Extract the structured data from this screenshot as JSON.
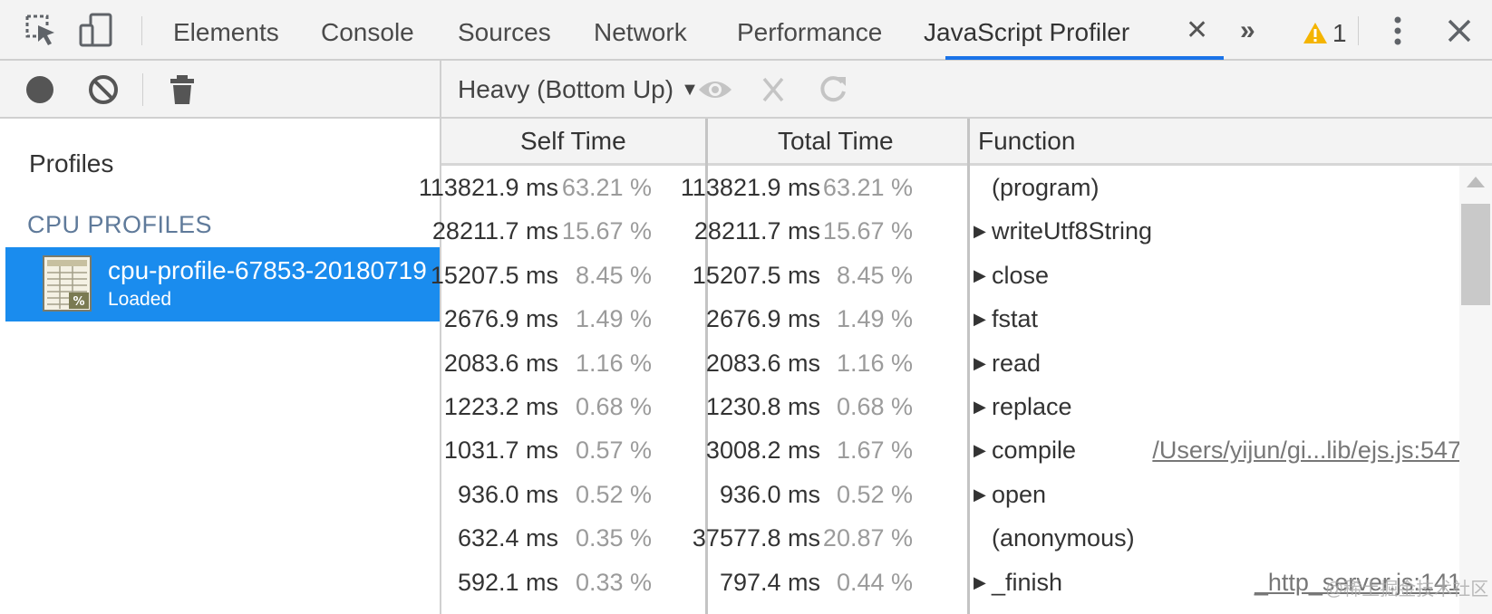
{
  "tabs": [
    {
      "label": "Elements"
    },
    {
      "label": "Console"
    },
    {
      "label": "Sources"
    },
    {
      "label": "Network"
    },
    {
      "label": "Performance"
    },
    {
      "label": "JavaScript Profiler",
      "active": true
    }
  ],
  "warnings": {
    "count": "1"
  },
  "sidebar": {
    "title": "Profiles",
    "section_header": "CPU PROFILES",
    "profile": {
      "name": "cpu-profile-67853-20180719",
      "status": "Loaded"
    }
  },
  "toolbar": {
    "view_mode": "Heavy (Bottom Up)"
  },
  "table": {
    "columns": {
      "self_time": "Self Time",
      "total_time": "Total Time",
      "function": "Function"
    },
    "rows": [
      {
        "self_ms": "113821.9 ms",
        "self_pct": "63.21 %",
        "total_ms": "113821.9 ms",
        "total_pct": "63.21 %",
        "expandable": false,
        "function": "(program)",
        "url": ""
      },
      {
        "self_ms": "28211.7 ms",
        "self_pct": "15.67 %",
        "total_ms": "28211.7 ms",
        "total_pct": "15.67 %",
        "expandable": true,
        "function": "writeUtf8String",
        "url": ""
      },
      {
        "self_ms": "15207.5 ms",
        "self_pct": "8.45 %",
        "total_ms": "15207.5 ms",
        "total_pct": "8.45 %",
        "expandable": true,
        "function": "close",
        "url": ""
      },
      {
        "self_ms": "2676.9 ms",
        "self_pct": "1.49 %",
        "total_ms": "2676.9 ms",
        "total_pct": "1.49 %",
        "expandable": true,
        "function": "fstat",
        "url": ""
      },
      {
        "self_ms": "2083.6 ms",
        "self_pct": "1.16 %",
        "total_ms": "2083.6 ms",
        "total_pct": "1.16 %",
        "expandable": true,
        "function": "read",
        "url": ""
      },
      {
        "self_ms": "1223.2 ms",
        "self_pct": "0.68 %",
        "total_ms": "1230.8 ms",
        "total_pct": "0.68 %",
        "expandable": true,
        "function": "replace",
        "url": ""
      },
      {
        "self_ms": "1031.7 ms",
        "self_pct": "0.57 %",
        "total_ms": "3008.2 ms",
        "total_pct": "1.67 %",
        "expandable": true,
        "function": "compile",
        "url": "/Users/yijun/gi...lib/ejs.js:547"
      },
      {
        "self_ms": "936.0 ms",
        "self_pct": "0.52 %",
        "total_ms": "936.0 ms",
        "total_pct": "0.52 %",
        "expandable": true,
        "function": "open",
        "url": ""
      },
      {
        "self_ms": "632.4 ms",
        "self_pct": "0.35 %",
        "total_ms": "37577.8 ms",
        "total_pct": "20.87 %",
        "expandable": false,
        "function": "(anonymous)",
        "url": ""
      },
      {
        "self_ms": "592.1 ms",
        "self_pct": "0.33 %",
        "total_ms": "797.4 ms",
        "total_pct": "0.44 %",
        "expandable": true,
        "function": "_finish",
        "url": "_http_server.js:141"
      }
    ]
  },
  "colors": {
    "accent": "#1a73e8",
    "selection": "#1a8cee",
    "warning": "#f4b400"
  },
  "watermark": "@稀土掘金技术社区"
}
